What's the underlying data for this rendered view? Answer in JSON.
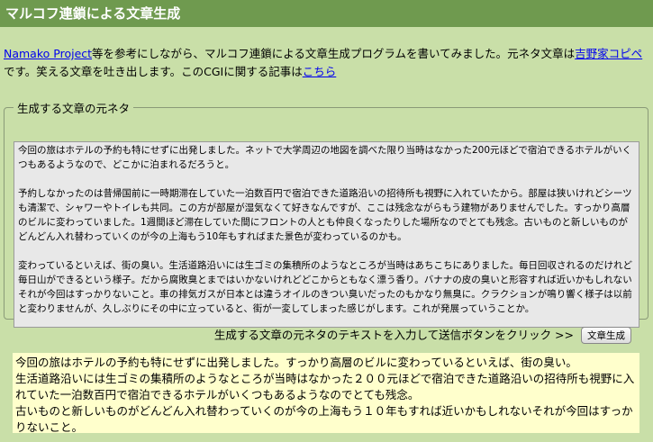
{
  "header": {
    "title": "マルコフ連鎖による文章生成"
  },
  "intro": {
    "link_namako": "Namako Project",
    "text1": "等を参考にしながら、マルコフ連鎖による文章生成プログラムを書いてみました。元ネタ文章は",
    "link_source": "吉野家コピペ",
    "text2": "です。笑える文章を吐き出します。このCGIに関する記事は",
    "link_article": "こちら"
  },
  "source_form": {
    "legend": "生成する文章の元ネタ",
    "textarea_value": "今回の旅はホテルの予約も特にせずに出発しました。ネットで大学周辺の地図を調べた限り当時はなかった200元ほどで宿泊できるホテルがいくつもあるようなので、どこかに泊まれるだろうと。\n\n予約しなかったのは昔帰国前に一時期滞在していた一泊数百円で宿泊できた道路沿いの招待所も視野に入れていたから。部屋は狭いけれどシーツも清潔で、シャワーやトイレも共同。この方が部屋が湿気なくて好きなんですが、ここは残念ながらもう建物がありませんでした。すっかり高層のビルに変わっていました。1週間ほど滞在していた間にフロントの人とも仲良くなったりした場所なのでとても残念。古いものと新しいものがどんどん入れ替わっていくのが今の上海もう10年もすればまた景色が変わっているのかも。\n\n変わっているといえば、街の臭い。生活道路沿いには生ゴミの集積所のようなところが当時はあちこちにありました。毎日回収されるのだけれど毎日山ができるという様子。だから腐敗臭とまではいかないけれどどこからともなく漂う香り。バナナの皮の臭いと形容すれば近いかもしれないそれが今回はすっかりないこと。車の排気ガスが日本とは違うオイルのきつい臭いだったのもかなり無臭に。クラクションが鳴り響く様子は以前と変わりませんが、久しぶりにその中に立っていると、街が一変してしまった感じがします。これが発展っていうことか。"
  },
  "submit": {
    "instruction": "生成する文章の元ネタのテキストを入力して送信ボタンをクリック >>",
    "button_label": "文章生成"
  },
  "output": {
    "lines": [
      "今回の旅はホテルの予約も特にせずに出発しました。すっかり高層のビルに変わっているといえば、街の臭い。",
      "生活道路沿いには生ゴミの集積所のようなところが当時はなかった２００元ほどで宿泊できた道路沿いの招待所も視野に入れていた一泊数百円で宿泊できるホテルがいくつもあるようなのでとても残念。",
      "古いものと新しいものがどんどん入れ替わっていくのが今の上海もう１０年もすれば近いかもしれないそれが今回はすっかりないこと。"
    ]
  }
}
